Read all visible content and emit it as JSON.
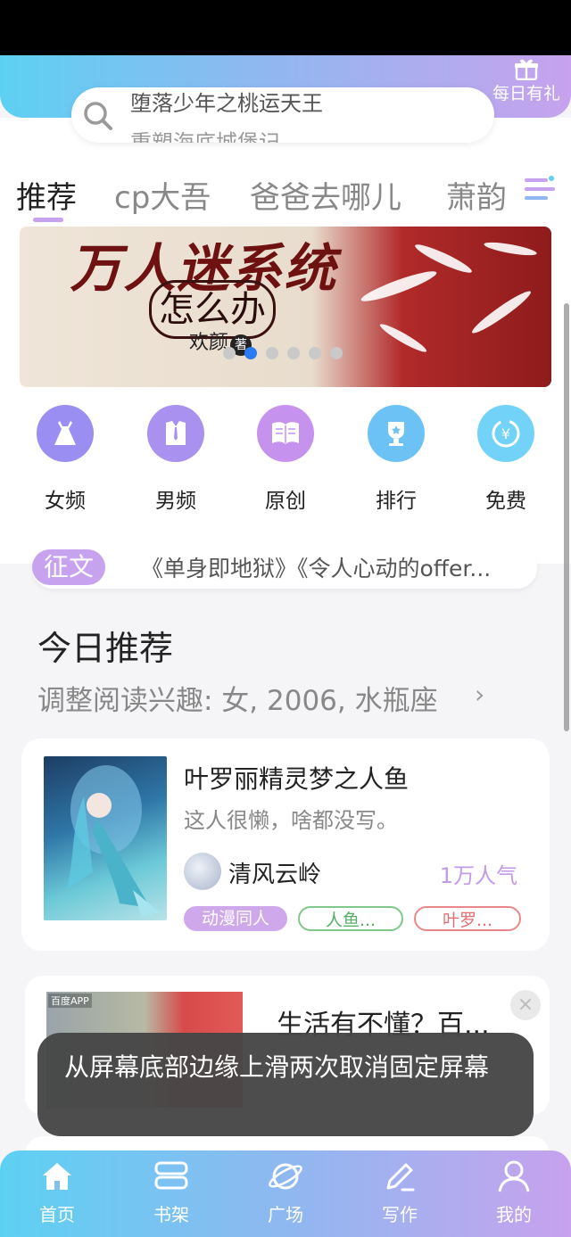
{
  "header": {
    "daily_gift_label": "每日有礼",
    "search_lines": [
      "堕落少年之桃运天王",
      "重塑海底城堡记"
    ]
  },
  "tabs": [
    {
      "label": "推荐",
      "active": true
    },
    {
      "label": "cp大吾",
      "active": false
    },
    {
      "label": "爸爸去哪儿",
      "active": false
    },
    {
      "label": "萧韵",
      "active": false
    }
  ],
  "banner": {
    "title": "万人迷系统",
    "subtitle": "怎么办",
    "author": "欢颜",
    "author_mark": "著",
    "dots_count": 6,
    "active_dot": 1
  },
  "categories": [
    {
      "label": "女频",
      "icon": "dress-icon",
      "color": "#9b8ef2"
    },
    {
      "label": "男频",
      "icon": "suit-icon",
      "color": "#a991f0"
    },
    {
      "label": "原创",
      "icon": "book-icon",
      "color": "#c592ee"
    },
    {
      "label": "排行",
      "icon": "trophy-icon",
      "color": "#6cc2f5"
    },
    {
      "label": "免费",
      "icon": "yuan-icon",
      "color": "#72d2f7"
    }
  ],
  "notice": {
    "badge": "征文",
    "text": "《单身即地狱》《令人心动的offer..."
  },
  "today": {
    "title": "今日推荐",
    "subtitle": "调整阅读兴趣: 女, 2006, 水瓶座",
    "arrow": "›"
  },
  "book": {
    "title": "叶罗丽精灵梦之人鱼",
    "desc": "这人很懒，啥都没写。",
    "author": "清风云岭",
    "popularity": "1万人气",
    "tags": [
      "动漫同人",
      "人鱼...",
      "叶罗..."
    ]
  },
  "ad": {
    "label": "百度APP",
    "title": "生活有不懂？百...",
    "close": "×"
  },
  "toast": {
    "text": "从屏幕底部边缘上滑两次取消固定屏幕"
  },
  "nav": [
    {
      "label": "首页",
      "icon": "home-icon"
    },
    {
      "label": "书架",
      "icon": "bookshelf-icon"
    },
    {
      "label": "广场",
      "icon": "planet-icon"
    },
    {
      "label": "写作",
      "icon": "pen-icon"
    },
    {
      "label": "我的",
      "icon": "user-icon"
    }
  ],
  "colors": {
    "accent_purple": "#c7a2ee",
    "accent_blue": "#5dd0f2"
  }
}
